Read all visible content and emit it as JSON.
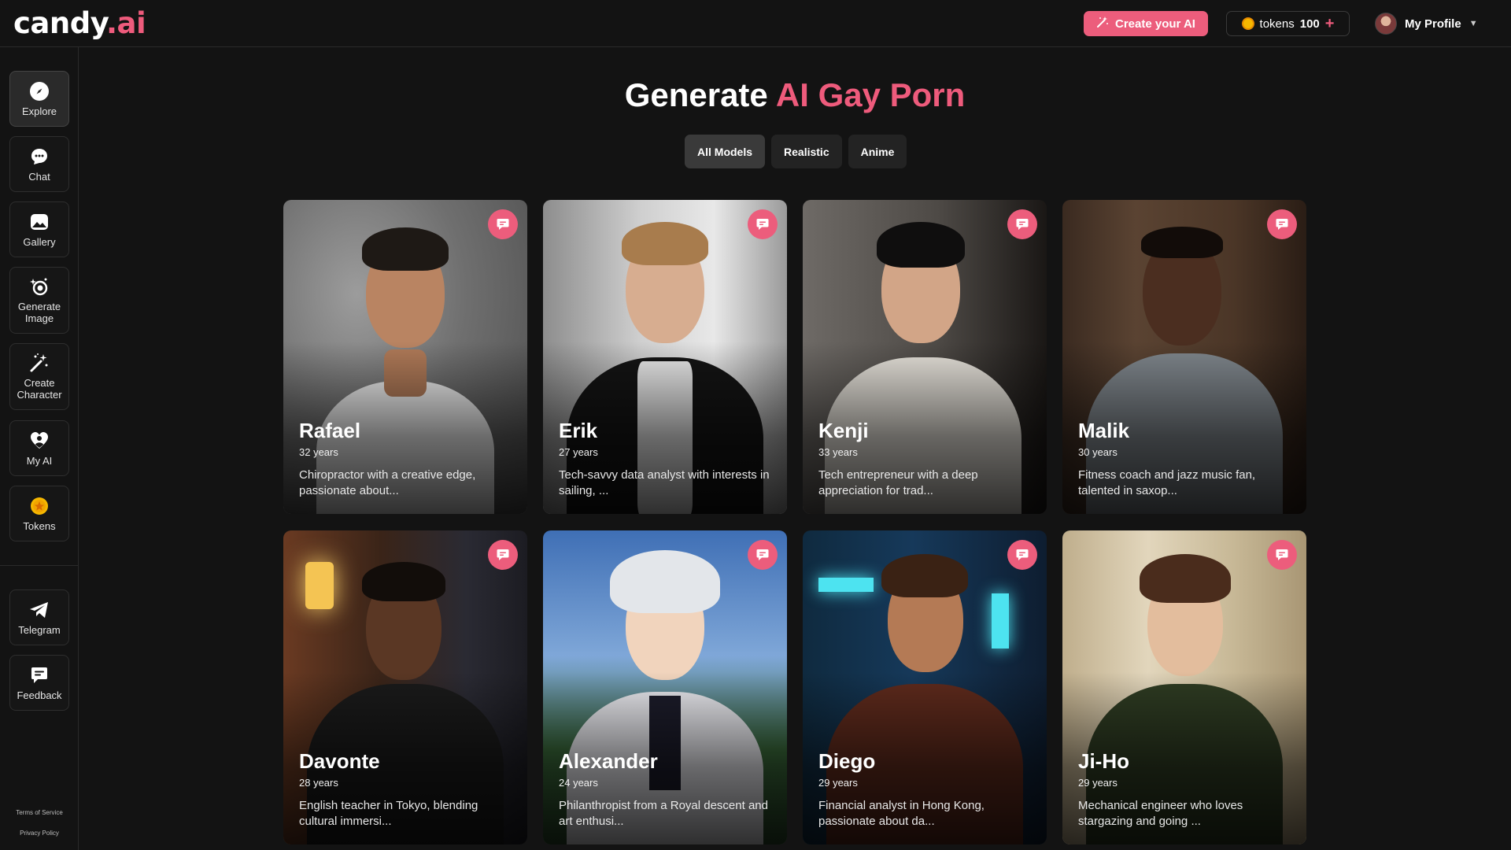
{
  "header": {
    "logo_main": "candy",
    "logo_accent": ".ai",
    "create_label": "Create your AI",
    "tokens_label": "tokens",
    "tokens_value": "100",
    "profile_label": "My Profile"
  },
  "sidebar": {
    "items": [
      {
        "label": "Explore",
        "icon": "compass-icon"
      },
      {
        "label": "Chat",
        "icon": "chat-bubble-icon"
      },
      {
        "label": "Gallery",
        "icon": "image-icon"
      },
      {
        "label": "Generate Image",
        "icon": "camera-sparkle-icon"
      },
      {
        "label": "Create Character",
        "icon": "magic-wand-icon"
      },
      {
        "label": "My AI",
        "icon": "heart-icon"
      },
      {
        "label": "Tokens",
        "icon": "coin-icon"
      },
      {
        "label": "Telegram",
        "icon": "telegram-icon"
      },
      {
        "label": "Feedback",
        "icon": "feedback-icon"
      }
    ],
    "terms": "Terms of Service",
    "privacy": "Privacy Policy"
  },
  "main": {
    "title_plain": "Generate",
    "title_accent": "AI Gay Porn",
    "filters": [
      "All Models",
      "Realistic",
      "Anime"
    ],
    "active_filter": "All Models"
  },
  "cards": [
    {
      "name": "Rafael",
      "age": "32 years",
      "desc": "Chiropractor with a creative edge, passionate about..."
    },
    {
      "name": "Erik",
      "age": "27 years",
      "desc": "Tech-savvy data analyst with interests in sailing, ..."
    },
    {
      "name": "Kenji",
      "age": "33 years",
      "desc": "Tech entrepreneur with a deep appreciation for trad..."
    },
    {
      "name": "Malik",
      "age": "30 years",
      "desc": "Fitness coach and jazz music fan, talented in saxop..."
    },
    {
      "name": "Davonte",
      "age": "28 years",
      "desc": "English teacher in Tokyo, blending cultural immersi..."
    },
    {
      "name": "Alexander",
      "age": "24 years",
      "desc": "Philanthropist from a Royal descent and art enthusi..."
    },
    {
      "name": "Diego",
      "age": "29 years",
      "desc": "Financial analyst in Hong Kong, passionate about da..."
    },
    {
      "name": "Ji-Ho",
      "age": "29 years",
      "desc": "Mechanical engineer who loves stargazing and going ..."
    }
  ],
  "colors": {
    "accent": "#ec5d7c",
    "background": "#131313"
  }
}
